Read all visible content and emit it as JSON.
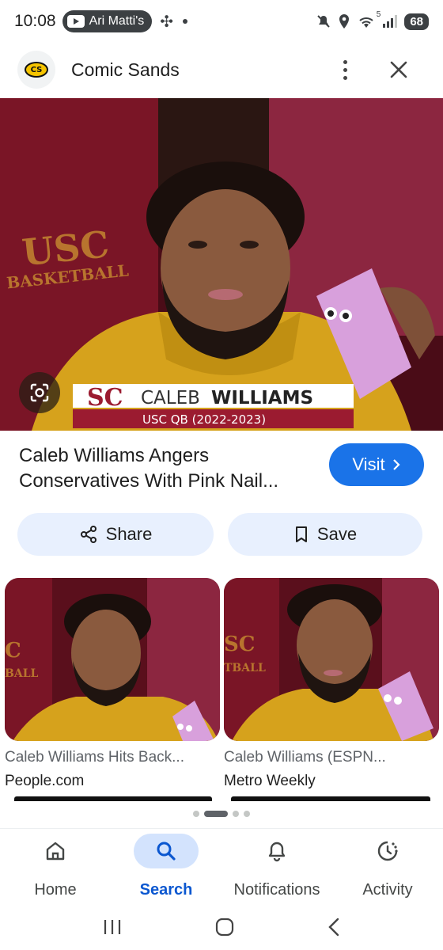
{
  "status_bar": {
    "time": "10:08",
    "notification_label": "Ari Matti's",
    "battery": "68",
    "wifi_badge": "5"
  },
  "header": {
    "site_name": "Comic Sands",
    "logo_text": "CS"
  },
  "hero": {
    "lower_third_name_first": "CALEB",
    "lower_third_name_last": "WILLIAMS",
    "lower_third_sub": "USC QB (2022-2023)",
    "shirt_text_1": "USC",
    "shirt_text_2": "BASKETBALL"
  },
  "result": {
    "title": "Caleb Williams Angers Conservatives With Pink Nail...",
    "visit_label": "Visit"
  },
  "actions": {
    "share_label": "Share",
    "save_label": "Save"
  },
  "related": [
    {
      "title": "Caleb Williams Hits Back...",
      "source": "People.com",
      "badge_text_1": "C",
      "badge_text_2": "BALL"
    },
    {
      "title": "Caleb Williams (ESPN...",
      "source": "Metro Weekly",
      "badge_text_1": "SC",
      "badge_text_2": "TBALL"
    }
  ],
  "bottom_nav": [
    {
      "label": "Home",
      "icon": "home-icon"
    },
    {
      "label": "Search",
      "icon": "search-icon",
      "active": true
    },
    {
      "label": "Notifications",
      "icon": "bell-icon"
    },
    {
      "label": "Activity",
      "icon": "activity-icon"
    }
  ],
  "colors": {
    "accent": "#1a73e8",
    "active_nav": "#0b57d0",
    "action_bg": "#e8f0fe",
    "usc_cardinal": "#9b1b30",
    "usc_gold": "#f0b400"
  }
}
